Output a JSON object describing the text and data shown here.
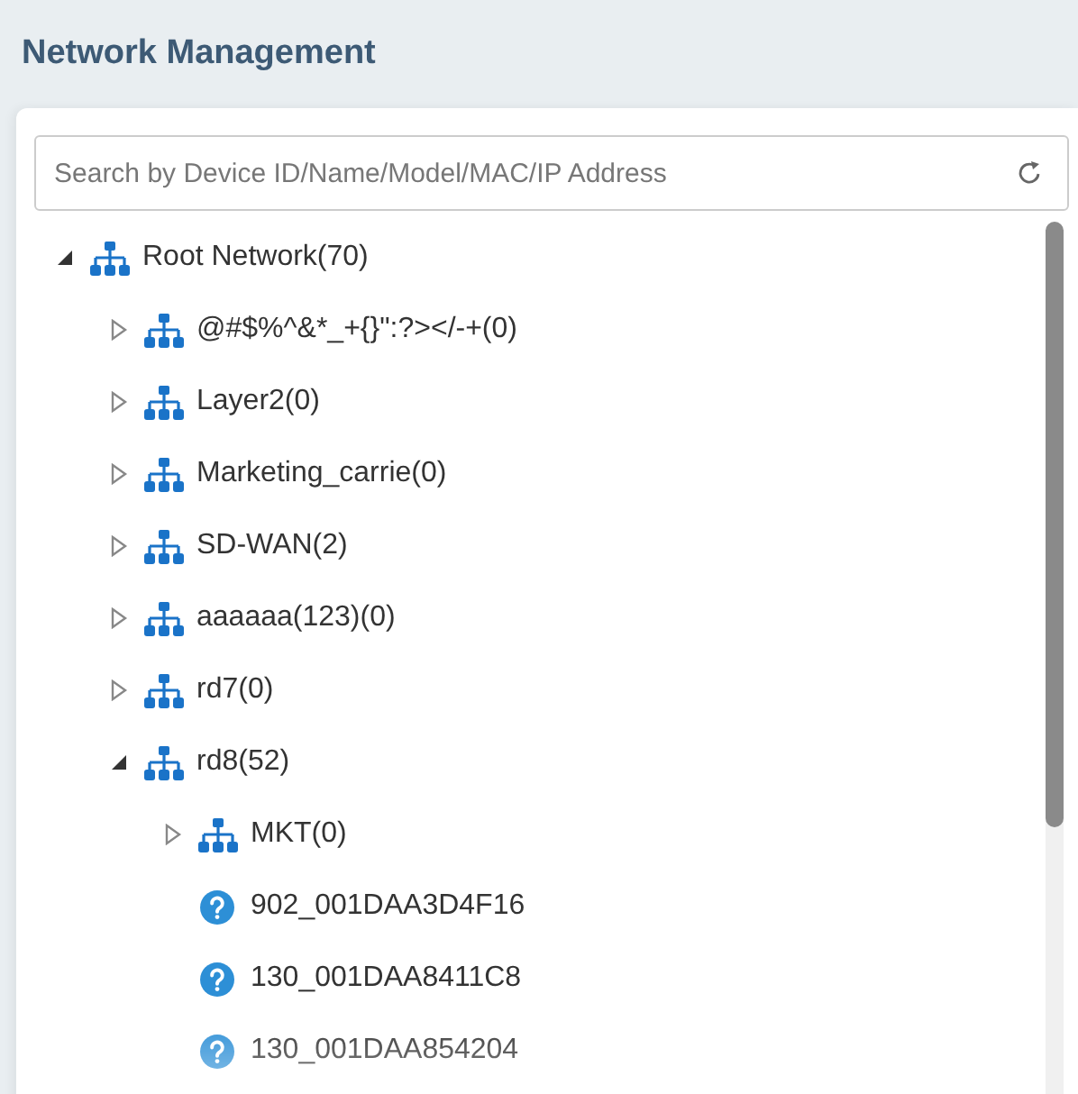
{
  "title": "Network Management",
  "search": {
    "placeholder": "Search by Device ID/Name/Model/MAC/IP Address"
  },
  "tree": [
    {
      "kind": "group",
      "label": "Root Network(70)",
      "expanded": true,
      "children": [
        {
          "kind": "group",
          "label": "@#$%^&*_+{}\":?></-+(0)",
          "expanded": false
        },
        {
          "kind": "group",
          "label": "Layer2(0)",
          "expanded": false
        },
        {
          "kind": "group",
          "label": "Marketing_carrie(0)",
          "expanded": false
        },
        {
          "kind": "group",
          "label": "SD-WAN(2)",
          "expanded": false
        },
        {
          "kind": "group",
          "label": "aaaaaa(123)(0)",
          "expanded": false
        },
        {
          "kind": "group",
          "label": "rd7(0)",
          "expanded": false
        },
        {
          "kind": "group",
          "label": "rd8(52)",
          "expanded": true,
          "children": [
            {
              "kind": "group",
              "label": "MKT(0)",
              "expanded": false
            },
            {
              "kind": "device",
              "label": "902_001DAA3D4F16"
            },
            {
              "kind": "device",
              "label": "130_001DAA8411C8"
            },
            {
              "kind": "device",
              "label": "130_001DAA854204"
            }
          ]
        }
      ]
    }
  ]
}
